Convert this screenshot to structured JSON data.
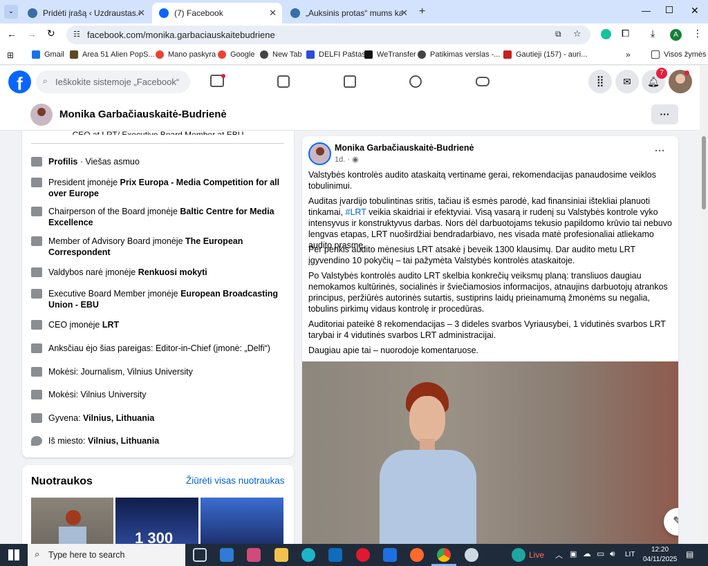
{
  "browser": {
    "tabs": [
      {
        "title": "Pridėti įrašą ‹ Uzdraustas.com — WordPress"
      },
      {
        "title": "(7) Facebook"
      },
      {
        "title": "„Auksinis protas“ mums kainavo"
      }
    ],
    "url": "facebook.com/monika.garbaciauskaitebudriene",
    "bookmarks": [
      "Gmail",
      "Area 51 Alien PopS...",
      "Mano paskyra",
      "Google",
      "New Tab",
      "DELFI Paštas",
      "WeTransfer",
      "Patikimas verslas -...",
      "Gautieji (157) - auri..."
    ],
    "all_bookmarks": "Visos žymės",
    "profile_letter": "A"
  },
  "fb": {
    "search_placeholder": "Ieškokite sistemoje „Facebook“",
    "notif_count": "7",
    "profile_name": "Monika Garbačiauskaitė-Budrienė"
  },
  "intro": {
    "cut_text": "CEO at LRT/ Executive Board Member at EBU",
    "items": [
      {
        "a": "Profilis",
        "b": " · Viešas asmuo"
      },
      {
        "a": "President įmonėje ",
        "b": "Prix Europa - Media Competition for all over Europe"
      },
      {
        "a": "Chairperson of the Board įmonėje ",
        "b": "Baltic Centre for Media Excellence"
      },
      {
        "a": "Member of Advisory Board įmonėje ",
        "b": "The European Correspondent"
      },
      {
        "a": "Valdybos narė įmonėje ",
        "b": "Renkuosi mokyti"
      },
      {
        "a": "Executive Board Member įmonėje ",
        "b": "European Broadcasting Union - EBU"
      },
      {
        "a": "CEO įmonėje ",
        "b": "LRT"
      },
      {
        "a": "Anksčiau ėjo šias pareigas: Editor-in-Chief (įmonė: „Delfi“)",
        "b": ""
      },
      {
        "a": "Mokėsi: Journalism, Vilnius University",
        "b": ""
      },
      {
        "a": "Mokėsi: Vilnius University",
        "b": ""
      },
      {
        "a": "Gyvena: ",
        "b": "Vilnius, Lithuania"
      },
      {
        "a": "Iš miesto: ",
        "b": "Vilnius, Lithuania"
      }
    ]
  },
  "photos": {
    "title": "Nuotraukos",
    "see_all": "Žiūrėti visas nuotraukas",
    "thumb_text": "1 300"
  },
  "post": {
    "author": "Monika Garbačiauskaitė-Budrienė",
    "time": "1d.",
    "p1": "Valstybės kontrolės audito ataskaitą vertiname gerai, rekomendacijas panaudosime veiklos tobulinimui.",
    "p2a": "Auditas įvardijo tobulintinas sritis, tačiau iš esmės parodė, kad finansiniai ištekliai planuoti tinkamai,",
    "p2tag": "#LRT",
    "p2b": " veikia skaidriai ir efektyviai. Visą vasarą ir rudenį su Valstybės kontrole vyko intensyvus ir konstruktyvus darbas. Nors dėl darbuotojams tekusio papildomo krūvio tai nebuvo lengvas etapas, LRT nuoširdžiai bendradarbiavo, nes visada matė profesionaliai atliekamo audito prasmę.",
    "p3": "Per penkis audito mėnesius LRT atsakė į beveik 1300 klausimų. Dar audito metu LRT įgyvendino 10 pokyčių – tai pažymėta Valstybės kontrolės ataskaitoje.",
    "p4": "Po Valstybės kontrolės audito LRT skelbia konkrečių veiksmų planą: transliuos daugiau nemokamos kultūrinės, socialinės ir šviečiamosios informacijos, atnaujins darbuotojų atrankos principus, peržiūrės autorinės sutartis, sustiprins laidų prieinamumą žmonėms su negalia, tobulins pirkimų vidaus kontrolę ir procedūras.",
    "p5": "Auditoriai pateikė 8 rekomendacijas – 3 dideles svarbos Vyriausybei, 1 vidutinės svarbos LRT tarybai ir 4 vidutinės svarbos LRT administracijai.",
    "p6": "Daugiau apie tai – nuorodoje komentaruose."
  },
  "taskbar": {
    "search": "Type here to search",
    "live": "Live",
    "lang": "LIT",
    "time": "12:20",
    "date": "04/11/2025"
  }
}
